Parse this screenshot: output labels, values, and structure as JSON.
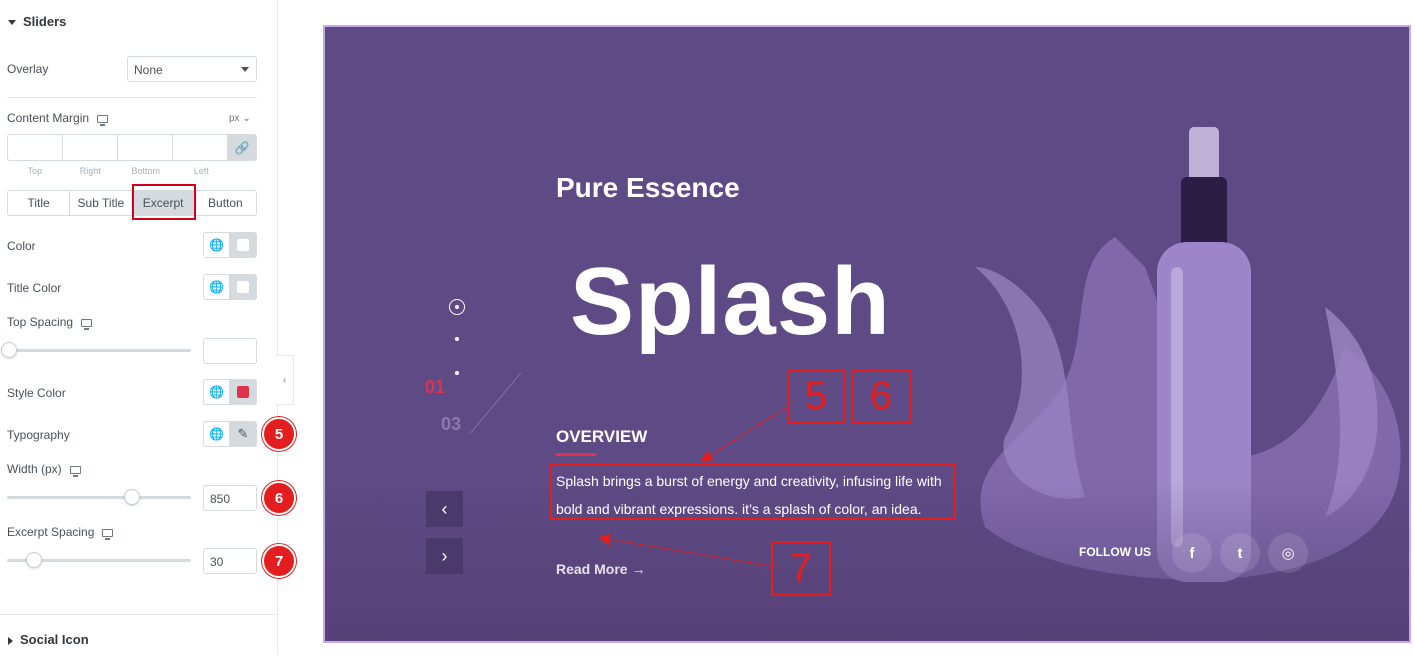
{
  "panel": {
    "section_title": "Sliders",
    "overlay_label": "Overlay",
    "overlay_value": "None",
    "content_margin_label": "Content Margin",
    "unit": "px",
    "margin_labels": [
      "Top",
      "Right",
      "Bottom",
      "Left"
    ],
    "tabs": [
      "Title",
      "Sub Title",
      "Excerpt",
      "Button"
    ],
    "active_tab": "Excerpt",
    "color_label": "Color",
    "title_color_label": "Title Color",
    "top_spacing_label": "Top Spacing",
    "style_color_label": "Style Color",
    "style_color": "#e0334a",
    "typography_label": "Typography",
    "width_label": "Width (px)",
    "width_value": "850",
    "excerpt_spacing_label": "Excerpt Spacing",
    "excerpt_spacing_value": "30",
    "social_section_title": "Social Icon",
    "badges": [
      "5",
      "6",
      "7"
    ]
  },
  "preview": {
    "subtitle": "Pure Essence",
    "title": "Splash",
    "overview": "OVERVIEW",
    "excerpt": "Splash brings a burst of energy and creativity, infusing life with bold and vibrant expressions. it’s a splash of color, an idea.",
    "read_more": "Read More →",
    "page_current": "01",
    "page_total": "03",
    "follow_us": "FOLLOW US",
    "social_icons": [
      "facebook-icon",
      "twitter-icon",
      "instagram-icon"
    ],
    "annotations": [
      "5",
      "6",
      "7"
    ]
  }
}
